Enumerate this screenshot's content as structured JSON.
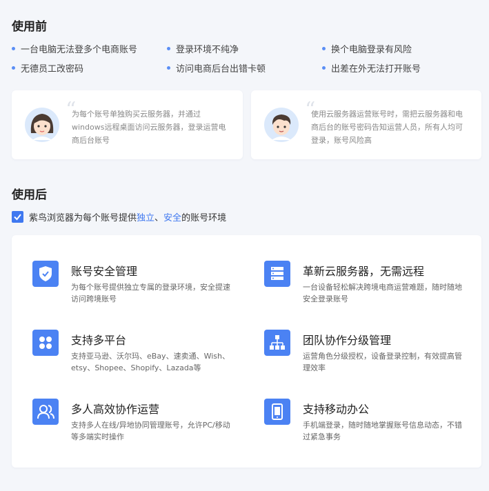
{
  "before": {
    "title": "使用前",
    "bullets": [
      "一台电脑无法登多个电商账号",
      "登录环境不纯净",
      "换个电脑登录有风险",
      "无德员工改密码",
      "访问电商后台出错卡顿",
      "出差在外无法打开账号"
    ],
    "cards": [
      {
        "quote": "“",
        "text": "为每个账号单独购买云服务器，并通过windows远程桌面访问云服务器，登录运营电商后台账号"
      },
      {
        "quote": "“",
        "text": "使用云服务器运营账号时，需把云服务器和电商后台的账号密码告知运营人员，所有人均可登录，账号风险高"
      }
    ]
  },
  "after": {
    "title": "使用后",
    "desc_prefix": "紫鸟浏览器为每个账号提供",
    "desc_hl1": "独立",
    "desc_sep": "、",
    "desc_hl2": "安全",
    "desc_suffix": "的账号环境"
  },
  "features": [
    {
      "icon": "shield-icon",
      "title": "账号安全管理",
      "desc": "为每个账号提供独立专属的登录环境，安全提速访问跨境账号"
    },
    {
      "icon": "server-icon",
      "title": "革新云服务器，无需远程",
      "desc": "一台设备轻松解决跨境电商运营难题，随时随地安全登录账号"
    },
    {
      "icon": "grid-icon",
      "title": "支持多平台",
      "desc": "支持亚马逊、沃尔玛、eBay、速卖通、Wish、etsy、Shopee、Shopify、Lazada等"
    },
    {
      "icon": "org-chart-icon",
      "title": "团队协作分级管理",
      "desc": "运营角色分级授权，设备登录控制，有效提高管理效率"
    },
    {
      "icon": "users-icon",
      "title": "多人高效协作运营",
      "desc": "支持多人在线/异地协同管理账号，允许PC/移动等多端实时操作"
    },
    {
      "icon": "mobile-icon",
      "title": "支持移动办公",
      "desc": "手机端登录，随时随地掌握账号信息动态，不错过紧急事务"
    }
  ],
  "colors": {
    "accent": "#3f78f0",
    "icon_bg": "#4b82f3",
    "icon_shadow": "#cfdcfb",
    "page_bg": "#f4f6fa"
  }
}
